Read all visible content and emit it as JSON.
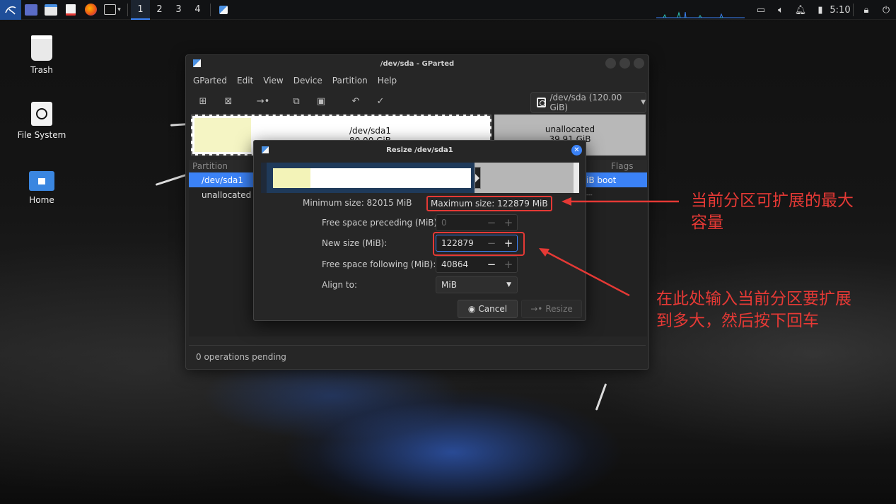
{
  "panel": {
    "workspaces": [
      "1",
      "2",
      "3",
      "4"
    ],
    "active_workspace": "1",
    "clock": "5:10",
    "icons": [
      "kali-menu-icon",
      "desktop-icon",
      "files-icon",
      "text-editor-icon",
      "firefox-icon",
      "terminal-icon",
      "gparted-task-icon",
      "screen-icon",
      "volume-icon",
      "bell-icon",
      "battery-icon",
      "lock-icon",
      "power-icon"
    ]
  },
  "desktop": {
    "icons": [
      {
        "label": "Trash",
        "icon": "trash-icon"
      },
      {
        "label": "File System",
        "icon": "filesystem-icon"
      },
      {
        "label": "Home",
        "icon": "home-folder-icon"
      }
    ]
  },
  "gparted": {
    "title": "/dev/sda - GParted",
    "menu": [
      "GParted",
      "Edit",
      "View",
      "Device",
      "Partition",
      "Help"
    ],
    "device_selector": "/dev/sda (120.00 GiB)",
    "map": {
      "sda1_name": "/dev/sda1",
      "sda1_size": "80.00 GiB",
      "unalloc_name": "unallocated",
      "unalloc_size": "39.91 GiB"
    },
    "list": {
      "col_partition": "Partition",
      "col_flags": "Flags",
      "rows": [
        {
          "partition": "/dev/sda1",
          "flags": "iB  boot"
        },
        {
          "partition": "unallocated",
          "flags": "---"
        }
      ]
    },
    "status": "0 operations pending"
  },
  "resize_dialog": {
    "title": "Resize /dev/sda1",
    "minimum_size": "Minimum size: 82015 MiB",
    "maximum_size": "Maximum size: 122879 MiB",
    "fields": {
      "preceding_label": "Free space preceding (MiB):",
      "preceding_value": "0",
      "new_size_label": "New size (MiB):",
      "new_size_value": "122879",
      "following_label": "Free space following (MiB):",
      "following_value": "40864",
      "align_label": "Align to:",
      "align_value": "MiB"
    },
    "cancel_label": "Cancel",
    "resize_label": "Resize"
  },
  "annotations": {
    "note1_line1": "当前分区可扩展的最大",
    "note1_line2": "容量",
    "note2_line1": "在此处输入当前分区要扩展",
    "note2_line2": "到多大，然后按下回车",
    "color": "#e53935"
  }
}
